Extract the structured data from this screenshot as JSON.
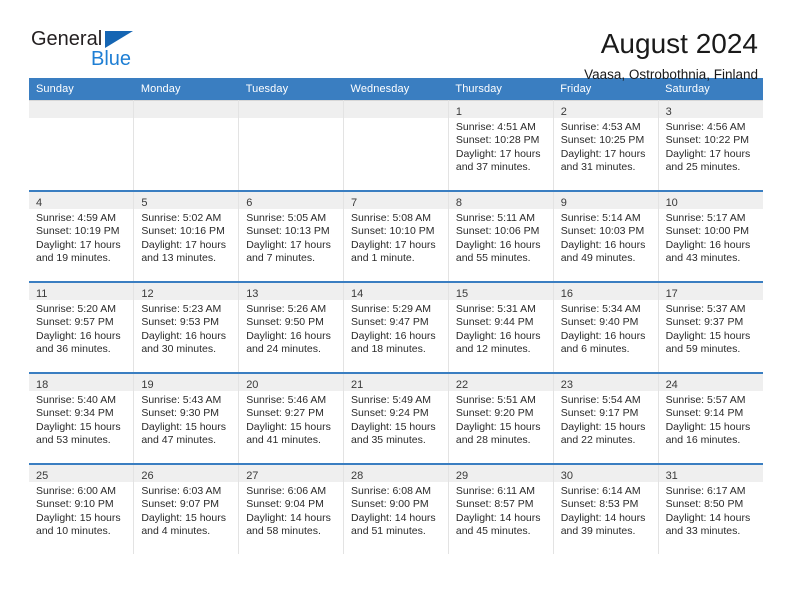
{
  "brand": {
    "name_part1": "General",
    "name_part2": "Blue",
    "triangle_icon": "blue-triangle-logo-mark",
    "color_dark": "#231f20",
    "color_blue": "#1f7fd4"
  },
  "header": {
    "title": "August 2024",
    "location": "Vaasa, Ostrobothnia, Finland"
  },
  "theme": {
    "header_blue": "#3a7ec1",
    "daynum_band": "#efefef",
    "grid_line": "#e3e3e3"
  },
  "calendar": {
    "weekday_headers": [
      "Sunday",
      "Monday",
      "Tuesday",
      "Wednesday",
      "Thursday",
      "Friday",
      "Saturday"
    ],
    "weeks": [
      [
        {
          "day": "",
          "sunrise": "",
          "sunset": "",
          "daylight_line1": "",
          "daylight_line2": ""
        },
        {
          "day": "",
          "sunrise": "",
          "sunset": "",
          "daylight_line1": "",
          "daylight_line2": ""
        },
        {
          "day": "",
          "sunrise": "",
          "sunset": "",
          "daylight_line1": "",
          "daylight_line2": ""
        },
        {
          "day": "",
          "sunrise": "",
          "sunset": "",
          "daylight_line1": "",
          "daylight_line2": ""
        },
        {
          "day": "1",
          "sunrise": "Sunrise: 4:51 AM",
          "sunset": "Sunset: 10:28 PM",
          "daylight_line1": "Daylight: 17 hours",
          "daylight_line2": "and 37 minutes."
        },
        {
          "day": "2",
          "sunrise": "Sunrise: 4:53 AM",
          "sunset": "Sunset: 10:25 PM",
          "daylight_line1": "Daylight: 17 hours",
          "daylight_line2": "and 31 minutes."
        },
        {
          "day": "3",
          "sunrise": "Sunrise: 4:56 AM",
          "sunset": "Sunset: 10:22 PM",
          "daylight_line1": "Daylight: 17 hours",
          "daylight_line2": "and 25 minutes."
        }
      ],
      [
        {
          "day": "4",
          "sunrise": "Sunrise: 4:59 AM",
          "sunset": "Sunset: 10:19 PM",
          "daylight_line1": "Daylight: 17 hours",
          "daylight_line2": "and 19 minutes."
        },
        {
          "day": "5",
          "sunrise": "Sunrise: 5:02 AM",
          "sunset": "Sunset: 10:16 PM",
          "daylight_line1": "Daylight: 17 hours",
          "daylight_line2": "and 13 minutes."
        },
        {
          "day": "6",
          "sunrise": "Sunrise: 5:05 AM",
          "sunset": "Sunset: 10:13 PM",
          "daylight_line1": "Daylight: 17 hours",
          "daylight_line2": "and 7 minutes."
        },
        {
          "day": "7",
          "sunrise": "Sunrise: 5:08 AM",
          "sunset": "Sunset: 10:10 PM",
          "daylight_line1": "Daylight: 17 hours",
          "daylight_line2": "and 1 minute."
        },
        {
          "day": "8",
          "sunrise": "Sunrise: 5:11 AM",
          "sunset": "Sunset: 10:06 PM",
          "daylight_line1": "Daylight: 16 hours",
          "daylight_line2": "and 55 minutes."
        },
        {
          "day": "9",
          "sunrise": "Sunrise: 5:14 AM",
          "sunset": "Sunset: 10:03 PM",
          "daylight_line1": "Daylight: 16 hours",
          "daylight_line2": "and 49 minutes."
        },
        {
          "day": "10",
          "sunrise": "Sunrise: 5:17 AM",
          "sunset": "Sunset: 10:00 PM",
          "daylight_line1": "Daylight: 16 hours",
          "daylight_line2": "and 43 minutes."
        }
      ],
      [
        {
          "day": "11",
          "sunrise": "Sunrise: 5:20 AM",
          "sunset": "Sunset: 9:57 PM",
          "daylight_line1": "Daylight: 16 hours",
          "daylight_line2": "and 36 minutes."
        },
        {
          "day": "12",
          "sunrise": "Sunrise: 5:23 AM",
          "sunset": "Sunset: 9:53 PM",
          "daylight_line1": "Daylight: 16 hours",
          "daylight_line2": "and 30 minutes."
        },
        {
          "day": "13",
          "sunrise": "Sunrise: 5:26 AM",
          "sunset": "Sunset: 9:50 PM",
          "daylight_line1": "Daylight: 16 hours",
          "daylight_line2": "and 24 minutes."
        },
        {
          "day": "14",
          "sunrise": "Sunrise: 5:29 AM",
          "sunset": "Sunset: 9:47 PM",
          "daylight_line1": "Daylight: 16 hours",
          "daylight_line2": "and 18 minutes."
        },
        {
          "day": "15",
          "sunrise": "Sunrise: 5:31 AM",
          "sunset": "Sunset: 9:44 PM",
          "daylight_line1": "Daylight: 16 hours",
          "daylight_line2": "and 12 minutes."
        },
        {
          "day": "16",
          "sunrise": "Sunrise: 5:34 AM",
          "sunset": "Sunset: 9:40 PM",
          "daylight_line1": "Daylight: 16 hours",
          "daylight_line2": "and 6 minutes."
        },
        {
          "day": "17",
          "sunrise": "Sunrise: 5:37 AM",
          "sunset": "Sunset: 9:37 PM",
          "daylight_line1": "Daylight: 15 hours",
          "daylight_line2": "and 59 minutes."
        }
      ],
      [
        {
          "day": "18",
          "sunrise": "Sunrise: 5:40 AM",
          "sunset": "Sunset: 9:34 PM",
          "daylight_line1": "Daylight: 15 hours",
          "daylight_line2": "and 53 minutes."
        },
        {
          "day": "19",
          "sunrise": "Sunrise: 5:43 AM",
          "sunset": "Sunset: 9:30 PM",
          "daylight_line1": "Daylight: 15 hours",
          "daylight_line2": "and 47 minutes."
        },
        {
          "day": "20",
          "sunrise": "Sunrise: 5:46 AM",
          "sunset": "Sunset: 9:27 PM",
          "daylight_line1": "Daylight: 15 hours",
          "daylight_line2": "and 41 minutes."
        },
        {
          "day": "21",
          "sunrise": "Sunrise: 5:49 AM",
          "sunset": "Sunset: 9:24 PM",
          "daylight_line1": "Daylight: 15 hours",
          "daylight_line2": "and 35 minutes."
        },
        {
          "day": "22",
          "sunrise": "Sunrise: 5:51 AM",
          "sunset": "Sunset: 9:20 PM",
          "daylight_line1": "Daylight: 15 hours",
          "daylight_line2": "and 28 minutes."
        },
        {
          "day": "23",
          "sunrise": "Sunrise: 5:54 AM",
          "sunset": "Sunset: 9:17 PM",
          "daylight_line1": "Daylight: 15 hours",
          "daylight_line2": "and 22 minutes."
        },
        {
          "day": "24",
          "sunrise": "Sunrise: 5:57 AM",
          "sunset": "Sunset: 9:14 PM",
          "daylight_line1": "Daylight: 15 hours",
          "daylight_line2": "and 16 minutes."
        }
      ],
      [
        {
          "day": "25",
          "sunrise": "Sunrise: 6:00 AM",
          "sunset": "Sunset: 9:10 PM",
          "daylight_line1": "Daylight: 15 hours",
          "daylight_line2": "and 10 minutes."
        },
        {
          "day": "26",
          "sunrise": "Sunrise: 6:03 AM",
          "sunset": "Sunset: 9:07 PM",
          "daylight_line1": "Daylight: 15 hours",
          "daylight_line2": "and 4 minutes."
        },
        {
          "day": "27",
          "sunrise": "Sunrise: 6:06 AM",
          "sunset": "Sunset: 9:04 PM",
          "daylight_line1": "Daylight: 14 hours",
          "daylight_line2": "and 58 minutes."
        },
        {
          "day": "28",
          "sunrise": "Sunrise: 6:08 AM",
          "sunset": "Sunset: 9:00 PM",
          "daylight_line1": "Daylight: 14 hours",
          "daylight_line2": "and 51 minutes."
        },
        {
          "day": "29",
          "sunrise": "Sunrise: 6:11 AM",
          "sunset": "Sunset: 8:57 PM",
          "daylight_line1": "Daylight: 14 hours",
          "daylight_line2": "and 45 minutes."
        },
        {
          "day": "30",
          "sunrise": "Sunrise: 6:14 AM",
          "sunset": "Sunset: 8:53 PM",
          "daylight_line1": "Daylight: 14 hours",
          "daylight_line2": "and 39 minutes."
        },
        {
          "day": "31",
          "sunrise": "Sunrise: 6:17 AM",
          "sunset": "Sunset: 8:50 PM",
          "daylight_line1": "Daylight: 14 hours",
          "daylight_line2": "and 33 minutes."
        }
      ]
    ]
  }
}
